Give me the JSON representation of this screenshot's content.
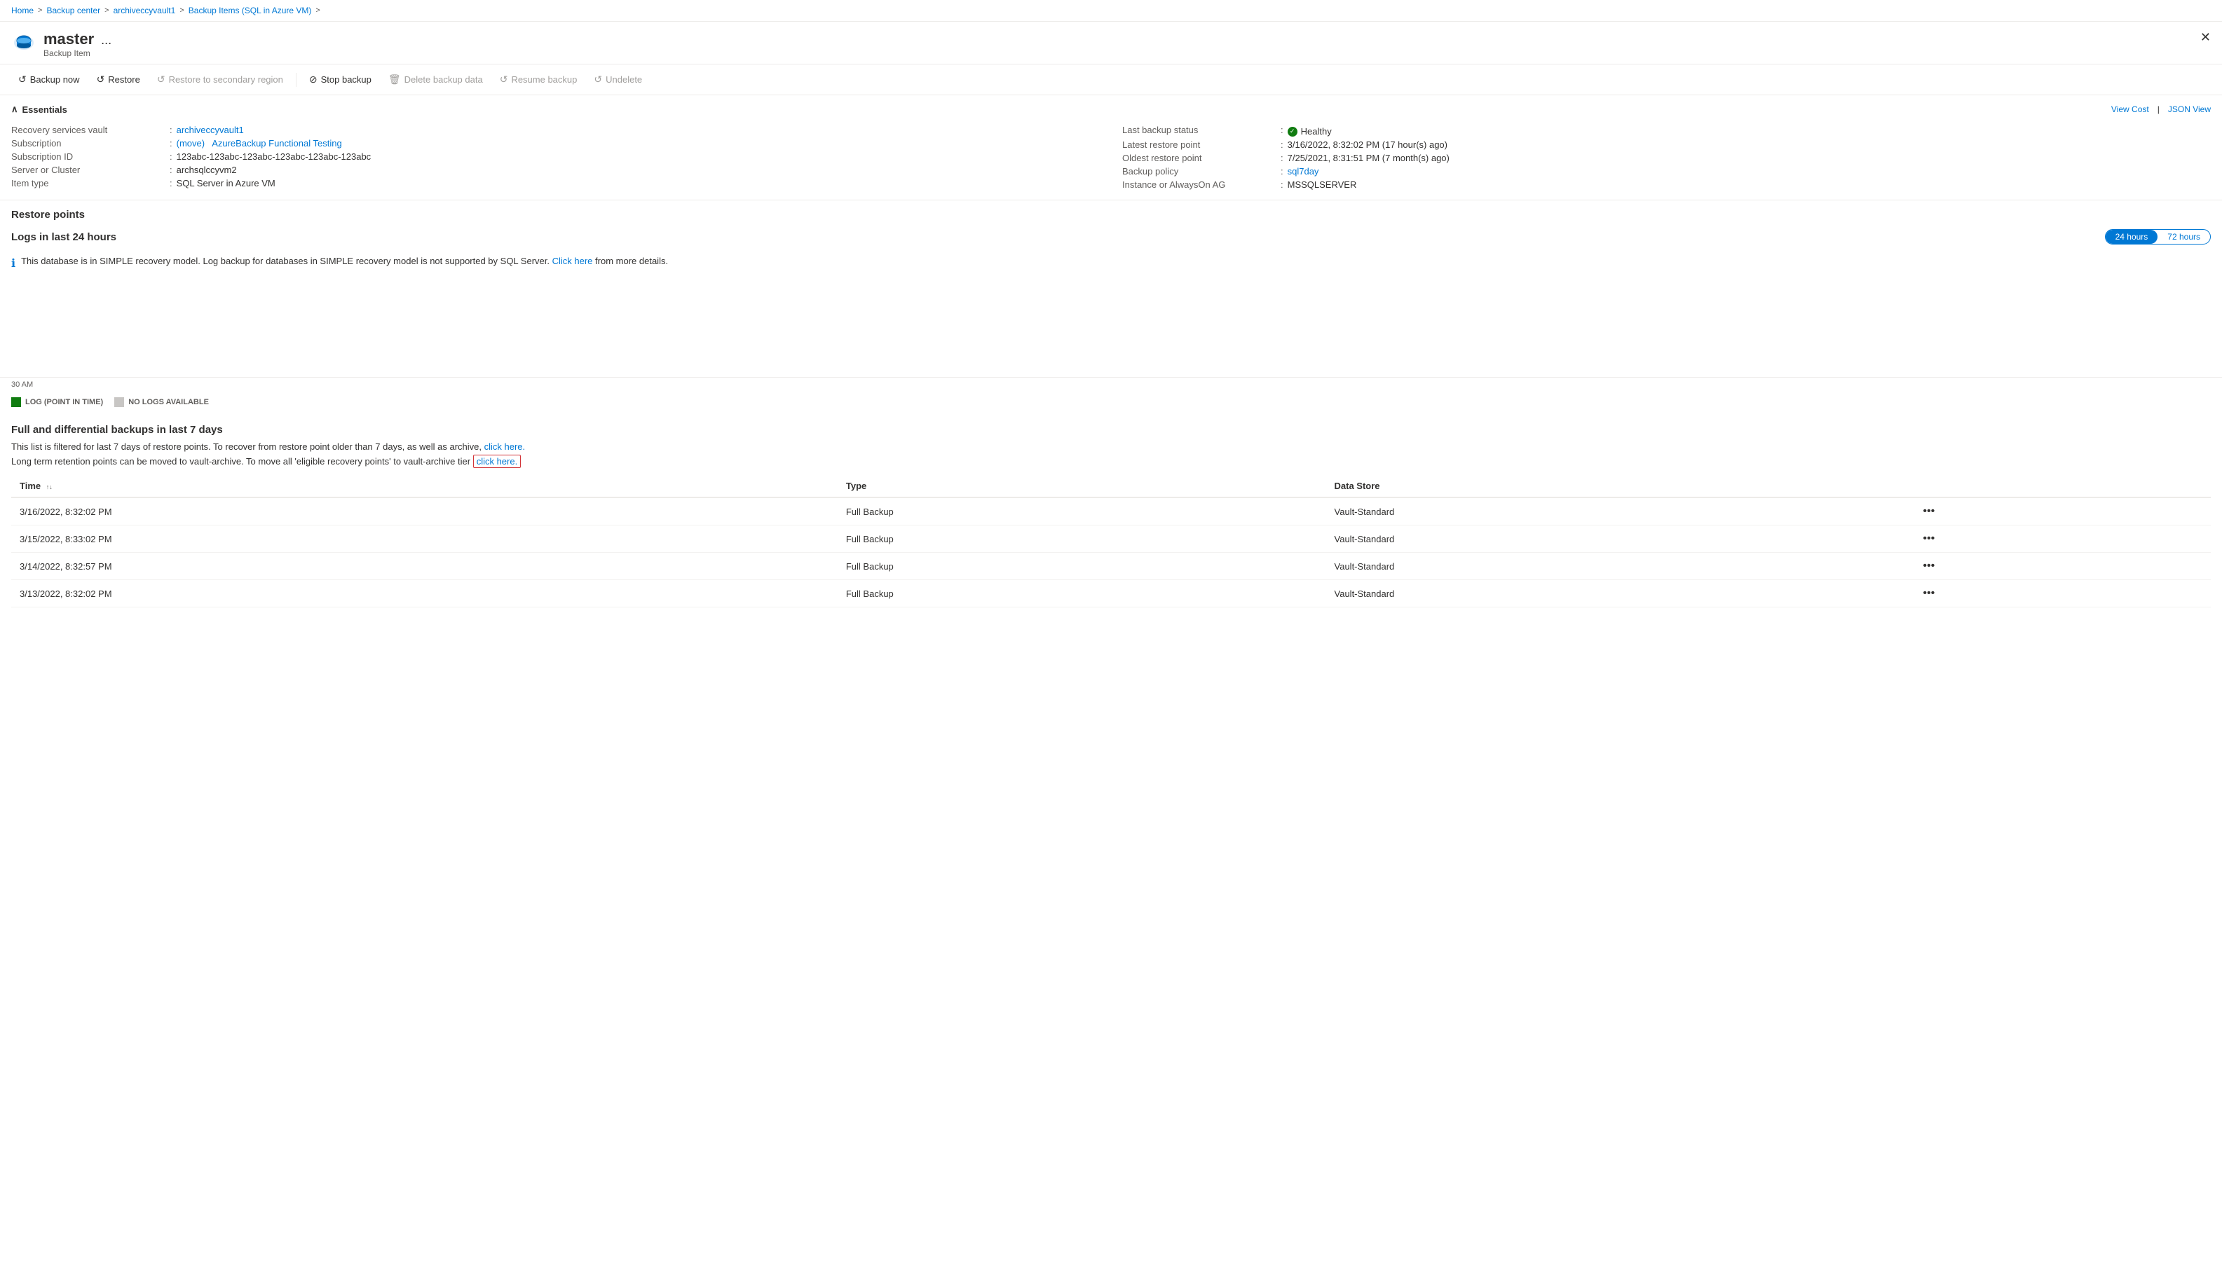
{
  "breadcrumb": {
    "items": [
      "Home",
      "Backup center",
      "archiveccyvault1",
      "Backup Items (SQL in Azure VM)"
    ]
  },
  "header": {
    "title": "master",
    "subtitle": "Backup Item",
    "dots_label": "..."
  },
  "toolbar": {
    "buttons": [
      {
        "id": "backup-now",
        "label": "Backup now",
        "icon": "↺",
        "disabled": false
      },
      {
        "id": "restore",
        "label": "Restore",
        "icon": "↺",
        "disabled": false
      },
      {
        "id": "restore-secondary",
        "label": "Restore to secondary region",
        "icon": "↺",
        "disabled": true
      },
      {
        "id": "stop-backup",
        "label": "Stop backup",
        "icon": "⊘",
        "disabled": false
      },
      {
        "id": "delete-backup",
        "label": "Delete backup data",
        "icon": "🗑",
        "disabled": true
      },
      {
        "id": "resume-backup",
        "label": "Resume backup",
        "icon": "↺",
        "disabled": true
      },
      {
        "id": "undelete",
        "label": "Undelete",
        "icon": "↺",
        "disabled": true
      }
    ]
  },
  "essentials": {
    "title": "Essentials",
    "view_cost": "View Cost",
    "json_view": "JSON View",
    "left_fields": [
      {
        "label": "Recovery services vault",
        "value": "archiveccyvault1",
        "link": true
      },
      {
        "label": "Subscription",
        "value": "AzureBackup Functional Testing",
        "prefix": "(move)",
        "link": true
      },
      {
        "label": "Subscription ID",
        "value": "123abc-123abc-123abc-123abc-123abc-123abc"
      },
      {
        "label": "Server or Cluster",
        "value": "archsqlccyvm2"
      },
      {
        "label": "Item type",
        "value": "SQL Server in Azure VM"
      }
    ],
    "right_fields": [
      {
        "label": "Last backup status",
        "value": "Healthy",
        "healthy": true
      },
      {
        "label": "Latest restore point",
        "value": "3/16/2022, 8:32:02 PM (17 hour(s) ago)"
      },
      {
        "label": "Oldest restore point",
        "value": "7/25/2021, 8:31:51 PM (7 month(s) ago)"
      },
      {
        "label": "Backup policy",
        "value": "sql7day",
        "link": true
      },
      {
        "label": "Instance or AlwaysOn AG",
        "value": "MSSQLSERVER"
      }
    ]
  },
  "restore_points": {
    "title": "Restore points"
  },
  "logs": {
    "title": "Logs in last 24 hours",
    "time_options": [
      "24 hours",
      "72 hours"
    ],
    "active_time": "24 hours"
  },
  "info_message": {
    "text": "This database is in SIMPLE recovery model. Log backup for databases in SIMPLE recovery model is not supported by SQL Server.",
    "link_text": "Click here",
    "link_suffix": "from more details."
  },
  "timeline": {
    "time_label": "30 AM",
    "legend": [
      {
        "label": "LOG (POINT IN TIME)",
        "color": "#107c10"
      },
      {
        "label": "NO LOGS AVAILABLE",
        "color": "#c8c6c4"
      }
    ]
  },
  "full_backup": {
    "title": "Full and differential backups in last 7 days",
    "desc1": "This list is filtered for last 7 days of restore points. To recover from restore point older than 7 days, as well as archive,",
    "desc1_link": "click here.",
    "desc2": "Long term retention points can be moved to vault-archive. To move all 'eligible recovery points' to vault-archive tier",
    "desc2_link": "click here.",
    "columns": [
      "Time",
      "Type",
      "Data Store"
    ],
    "rows": [
      {
        "time": "3/16/2022, 8:32:02 PM",
        "type": "Full Backup",
        "data_store": "Vault-Standard"
      },
      {
        "time": "3/15/2022, 8:33:02 PM",
        "type": "Full Backup",
        "data_store": "Vault-Standard"
      },
      {
        "time": "3/14/2022, 8:32:57 PM",
        "type": "Full Backup",
        "data_store": "Vault-Standard"
      },
      {
        "time": "3/13/2022, 8:32:02 PM",
        "type": "Full Backup",
        "data_store": "Vault-Standard"
      }
    ]
  }
}
